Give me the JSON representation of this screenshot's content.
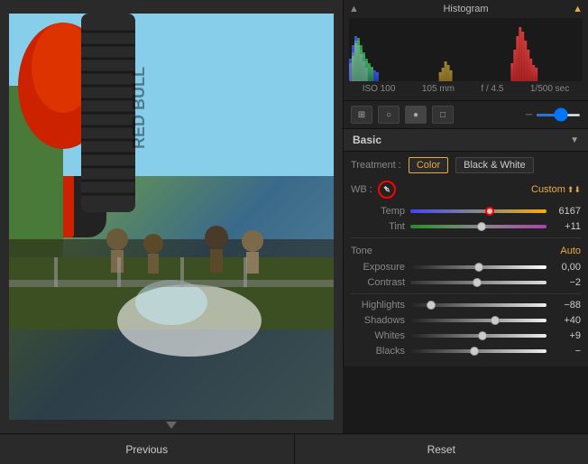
{
  "histogram": {
    "title": "Histogram",
    "exif": {
      "iso": "ISO 100",
      "focal": "105 mm",
      "aperture": "f / 4.5",
      "shutter": "1/500 sec"
    }
  },
  "tools": {
    "grid_icon": "⊞",
    "circle_icon": "○",
    "dot_icon": "●",
    "rect_icon": "□",
    "slider_icon": "—"
  },
  "sections": {
    "basic_label": "Basic"
  },
  "basic": {
    "treatment_label": "Treatment :",
    "color_btn": "Color",
    "bw_btn": "Black & White",
    "wb_label": "WB :",
    "wb_value": "Custom",
    "temp_label": "Temp",
    "temp_value": "6167",
    "tint_label": "Tint",
    "tint_value": "+11",
    "tone_label": "Tone",
    "auto_label": "Auto",
    "exposure_label": "Exposure",
    "exposure_value": "0,00",
    "contrast_label": "Contrast",
    "contrast_value": "−2",
    "highlights_label": "Highlights",
    "highlights_value": "−88",
    "shadows_label": "Shadows",
    "shadows_value": "+40",
    "whites_label": "Whites",
    "whites_value": "+9",
    "blacks_label": "Blacks",
    "blacks_value": "−"
  },
  "footer": {
    "previous_label": "Previous",
    "reset_label": "Reset"
  },
  "colors": {
    "accent": "#e8aa44",
    "active_treatment": "#e8aa44",
    "panel_bg": "#222222",
    "dark_bg": "#1a1a1a"
  }
}
